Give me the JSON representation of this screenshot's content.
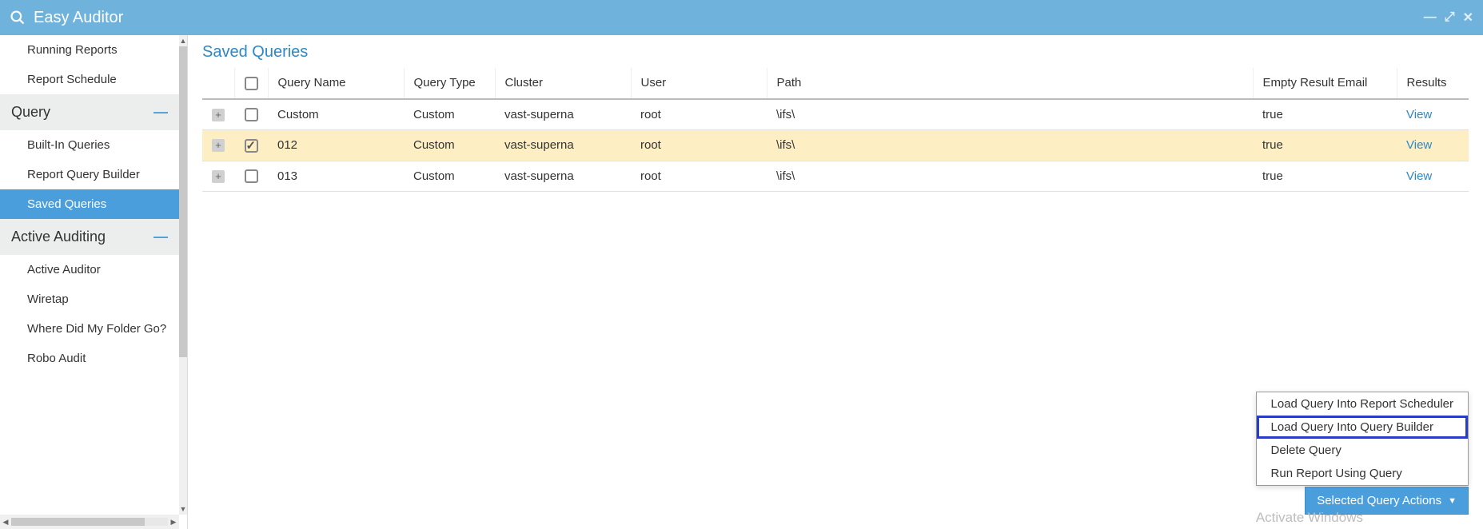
{
  "titlebar": {
    "app_title": "Easy Auditor"
  },
  "sidebar": {
    "top_items": [
      {
        "label": "Running Reports"
      },
      {
        "label": "Report Schedule"
      }
    ],
    "groups": [
      {
        "label": "Query",
        "items": [
          {
            "label": "Built-In Queries"
          },
          {
            "label": "Report Query Builder"
          },
          {
            "label": "Saved Queries",
            "active": true
          }
        ]
      },
      {
        "label": "Active Auditing",
        "items": [
          {
            "label": "Active Auditor"
          },
          {
            "label": "Wiretap"
          },
          {
            "label": "Where Did My Folder Go?"
          },
          {
            "label": "Robo Audit"
          }
        ]
      }
    ]
  },
  "main": {
    "title": "Saved Queries",
    "columns": {
      "query_name": "Query Name",
      "query_type": "Query Type",
      "cluster": "Cluster",
      "user": "User",
      "path": "Path",
      "empty_email": "Empty Result Email",
      "results": "Results"
    },
    "rows": [
      {
        "checked": false,
        "query_name": "Custom",
        "query_type": "Custom",
        "cluster": "vast-superna",
        "user": "root",
        "path": "\\ifs\\",
        "empty_email": "true",
        "results": "View"
      },
      {
        "checked": true,
        "query_name": "012",
        "query_type": "Custom",
        "cluster": "vast-superna",
        "user": "root",
        "path": "\\ifs\\",
        "empty_email": "true",
        "results": "View"
      },
      {
        "checked": false,
        "query_name": "013",
        "query_type": "Custom",
        "cluster": "vast-superna",
        "user": "root",
        "path": "\\ifs\\",
        "empty_email": "true",
        "results": "View"
      }
    ],
    "action_menu": [
      {
        "label": "Load Query Into Report Scheduler"
      },
      {
        "label": "Load Query Into Query Builder",
        "highlight": true
      },
      {
        "label": "Delete Query"
      },
      {
        "label": "Run Report Using Query"
      }
    ],
    "action_button": "Selected Query Actions"
  },
  "watermark": "Activate Windows"
}
